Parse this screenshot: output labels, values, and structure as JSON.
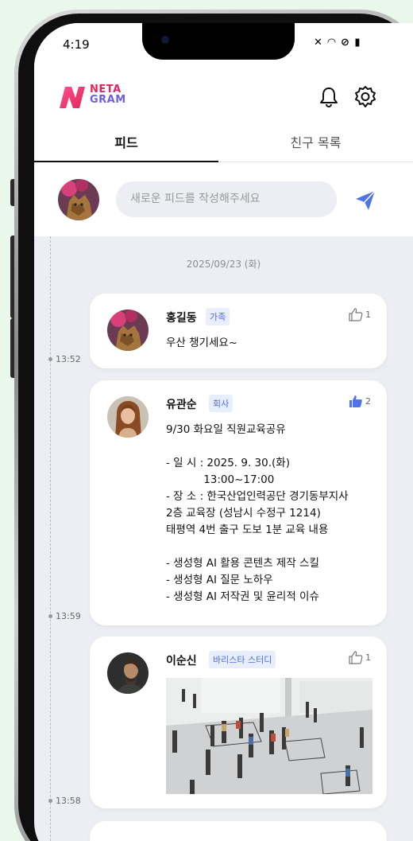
{
  "status": {
    "time": "4:19",
    "icons": "✕ ◠ ⊘ ▮"
  },
  "app": {
    "logo_line1": "NETA",
    "logo_line2": "GRAM"
  },
  "tabs": [
    {
      "label": "피드",
      "active": true
    },
    {
      "label": "친구 목록",
      "active": false
    }
  ],
  "composer": {
    "placeholder": "새로운 피드를 작성해주세요"
  },
  "feed": {
    "date": "2025/09/23 (화)",
    "posts": [
      {
        "author": "홍길동",
        "tag": "가족",
        "likes": "1",
        "liked": false,
        "time": "13:52",
        "text": "우산 챙기세요~"
      },
      {
        "author": "유관순",
        "tag": "회사",
        "likes": "2",
        "liked": true,
        "time": "13:59",
        "text": "9/30 화요일 직원교육공유\n\n- 일 시 : 2025. 9. 30.(화)\n           13:00~17:00\n- 장 소 : 한국산업인력공단 경기동부지사\n2층 교육장 (성남시 수정구 1214)\n태평역 4번 출구 도보 1분 교육 내용\n\n- 생성형 AI 활용 콘텐츠 제작 스킬\n- 생성형 AI 질문 노하우\n- 생성형 AI 저작권 및 윤리적 이슈"
      },
      {
        "author": "이순신",
        "tag": "바리스타 스터디",
        "likes": "1",
        "liked": false,
        "time": "13:58",
        "text": ""
      }
    ]
  },
  "colors": {
    "accent": "#4d6be4",
    "send": "#4f73e8",
    "like_active": "#4f73e8"
  }
}
